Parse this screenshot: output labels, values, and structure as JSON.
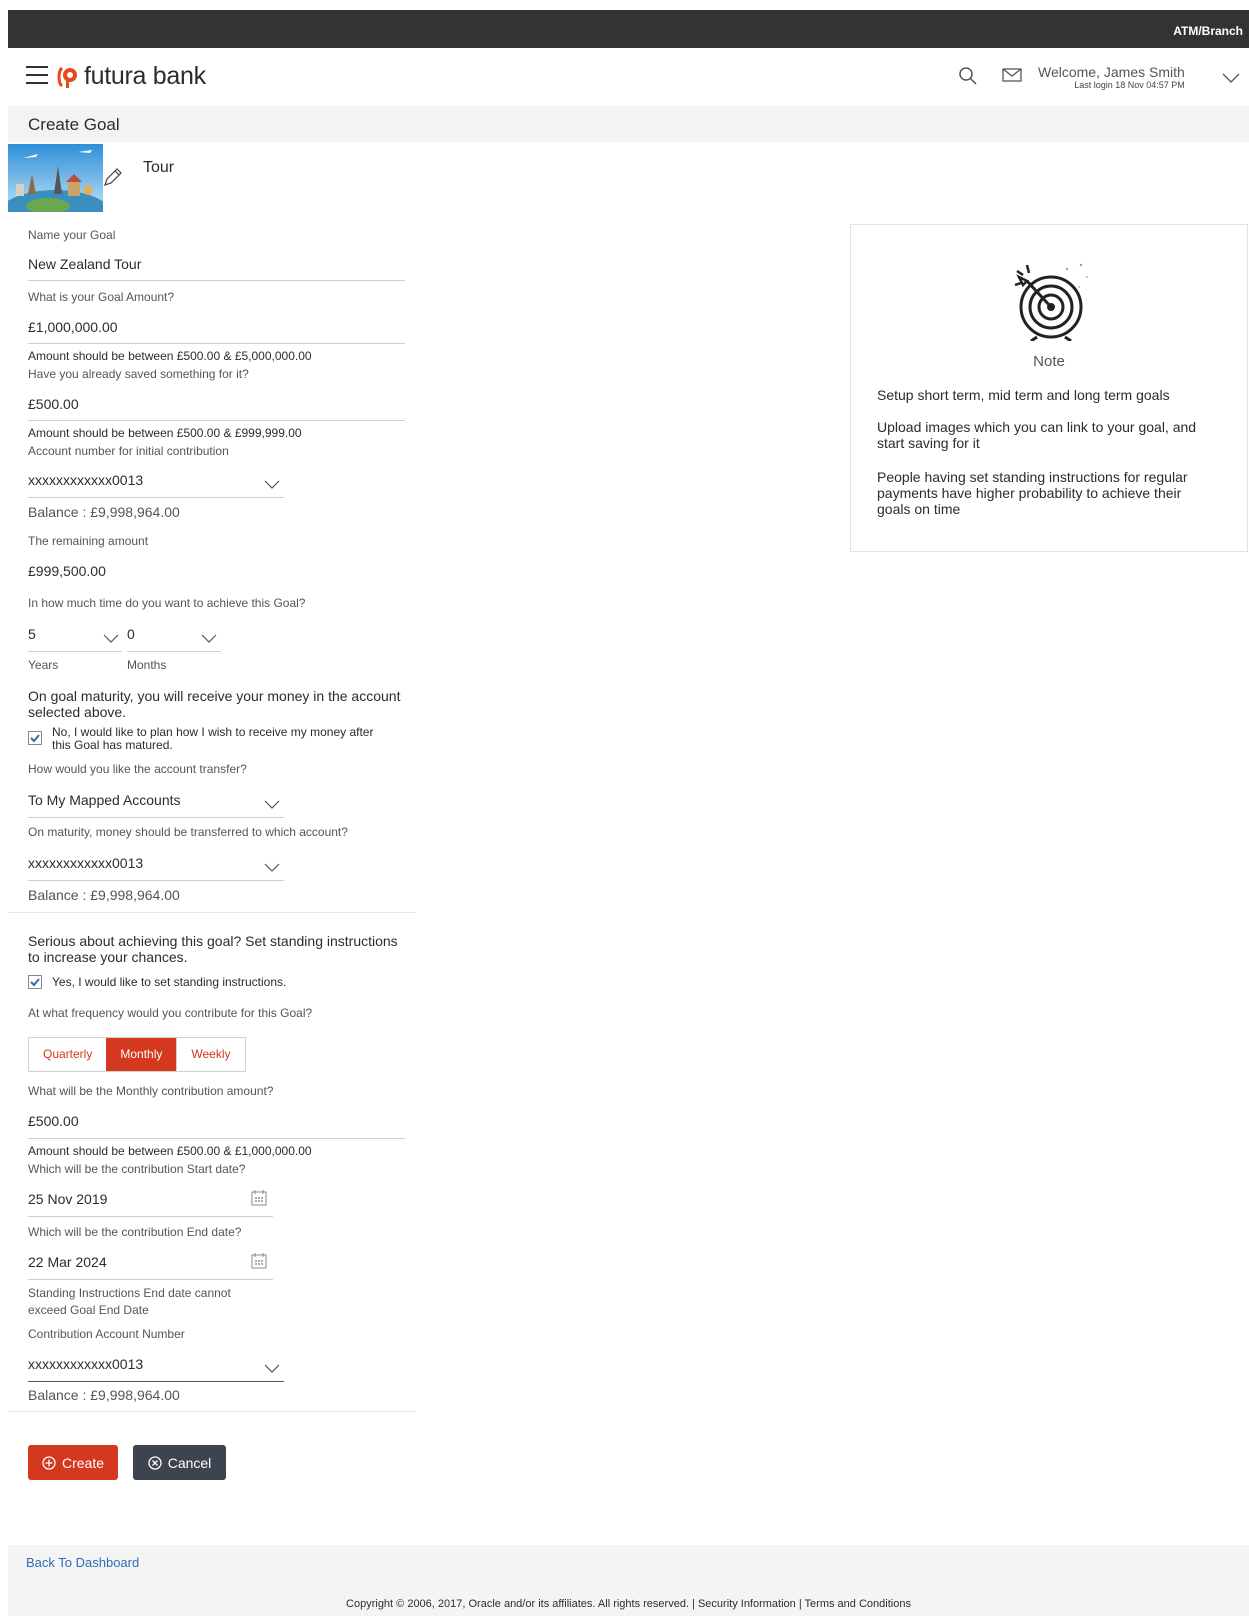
{
  "topbar": {
    "atm_branch": "ATM/Branch"
  },
  "header": {
    "brand": "futura bank",
    "welcome": "Welcome, James Smith",
    "last_login": "Last login 18 Nov 04:57 PM"
  },
  "page": {
    "title": "Create Goal"
  },
  "goal": {
    "category": "Tour"
  },
  "form": {
    "goal_name_label": "Name your Goal",
    "goal_name_value": "New Zealand Tour",
    "goal_amount_label": "What is your Goal Amount?",
    "goal_amount_value": "£1,000,000.00",
    "goal_amount_hint": "Amount should be between £500.00 & £5,000,000.00",
    "saved_label": "Have you already saved something for it?",
    "saved_value": "£500.00",
    "saved_hint": "Amount should be between £500.00 & £999,999.00",
    "initial_account_label": "Account number for initial contribution",
    "initial_account_value": "xxxxxxxxxxxx0013",
    "initial_account_balance": "Balance : £9,998,964.00",
    "remaining_label": "The remaining amount",
    "remaining_value": "£999,500.00",
    "time_label": "In how much time do you want to achieve this Goal?",
    "years_value": "5",
    "months_value": "0",
    "years_label": "Years",
    "months_label": "Months",
    "maturity_text": "On goal maturity, you will receive your money in the account selected above.",
    "maturity_checkbox_label": "No, I would like to plan how I wish to receive my money after this Goal has matured.",
    "transfer_label": "How would you like the account transfer?",
    "transfer_value": "To My Mapped Accounts",
    "maturity_account_label": "On maturity, money should be transferred to which account?",
    "maturity_account_value": "xxxxxxxxxxxx0013",
    "maturity_account_balance": "Balance : £9,998,964.00",
    "si_text": "Serious about achieving this goal? Set standing instructions to increase your chances.",
    "si_checkbox_label": "Yes, I would like to set standing instructions.",
    "frequency_label": "At what frequency would you contribute for this Goal?",
    "frequency_options": [
      "Quarterly",
      "Monthly",
      "Weekly"
    ],
    "frequency_selected": "Monthly",
    "contribution_label": "What will be the Monthly contribution amount?",
    "contribution_value": "£500.00",
    "contribution_hint": "Amount should be between £500.00 & £1,000,000.00",
    "start_date_label": "Which will be the contribution Start date?",
    "start_date_value": "25 Nov 2019",
    "end_date_label": "Which will be the contribution End date?",
    "end_date_value": "22 Mar 2024",
    "end_date_hint": "Standing Instructions End date cannot exceed Goal End Date",
    "contribution_account_label": "Contribution Account Number",
    "contribution_account_value": "xxxxxxxxxxxx0013",
    "contribution_account_balance": "Balance : £9,998,964.00"
  },
  "buttons": {
    "create": "Create",
    "cancel": "Cancel"
  },
  "note": {
    "title": "Note",
    "items": [
      "Setup short term, mid term and long term goals",
      "Upload images which you can link to your goal, and start saving for it",
      "People having set standing instructions for regular payments have higher probability to achieve their goals on time"
    ]
  },
  "footer": {
    "back_link": "Back To Dashboard",
    "copyright": "Copyright © 2006, 2017, Oracle and/or its affiliates. All rights reserved. | Security Information | Terms and Conditions"
  },
  "colors": {
    "accent": "#d4381e",
    "dark": "#333333",
    "cancel": "#3e4350",
    "link": "#2c6fb5"
  }
}
